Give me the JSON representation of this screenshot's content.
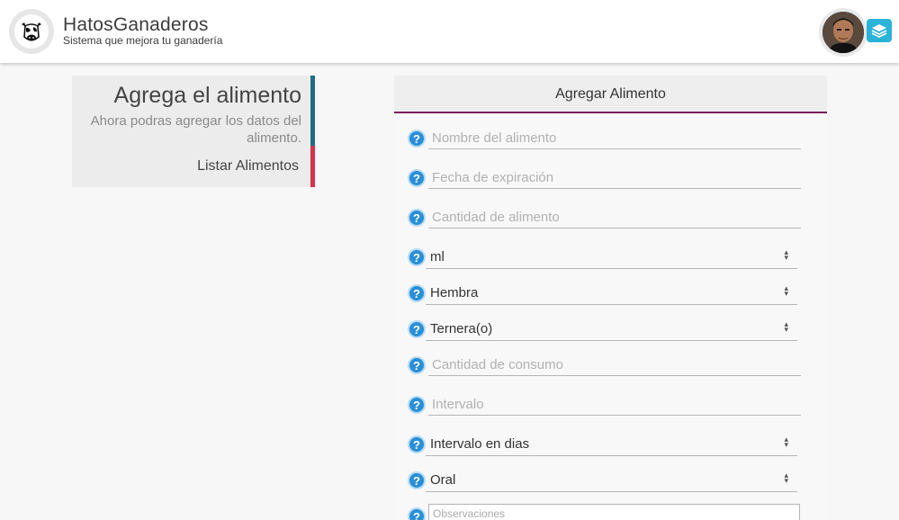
{
  "header": {
    "title": "HatosGanaderos",
    "subtitle": "Sistema que mejora tu ganadería"
  },
  "sidebar_box": {
    "title": "Agrega el alimento",
    "description": "Ahora podras agregar los datos del alimento.",
    "link": "Listar Alimentos"
  },
  "form": {
    "title": "Agregar Alimento",
    "help_glyph": "?",
    "fields": {
      "nombre": {
        "placeholder": "Nombre del alimento"
      },
      "fecha": {
        "placeholder": "Fecha de expiración"
      },
      "cantidad": {
        "placeholder": "Cantidad de alimento"
      },
      "unidad": {
        "value": "ml"
      },
      "sexo": {
        "value": "Hembra"
      },
      "etapa": {
        "value": "Ternera(o)"
      },
      "consumo": {
        "placeholder": "Cantidad de consumo"
      },
      "intervalo": {
        "placeholder": "Intervalo"
      },
      "intervalo_unidad": {
        "value": "Intervalo en dias"
      },
      "via": {
        "value": "Oral"
      },
      "observaciones": {
        "placeholder": "Observaciones"
      }
    }
  },
  "colors": {
    "accent_blue": "#1f6e86",
    "accent_red": "#d8334a",
    "panel_border": "#7a1a5a",
    "help_icon": "#2a8fd6",
    "layers_button": "#2bb3d8"
  },
  "icons": {
    "logo": "cow-logo-icon",
    "avatar": "user-avatar",
    "layers": "layers-icon",
    "help": "help-icon",
    "select": "select-arrows-icon"
  }
}
